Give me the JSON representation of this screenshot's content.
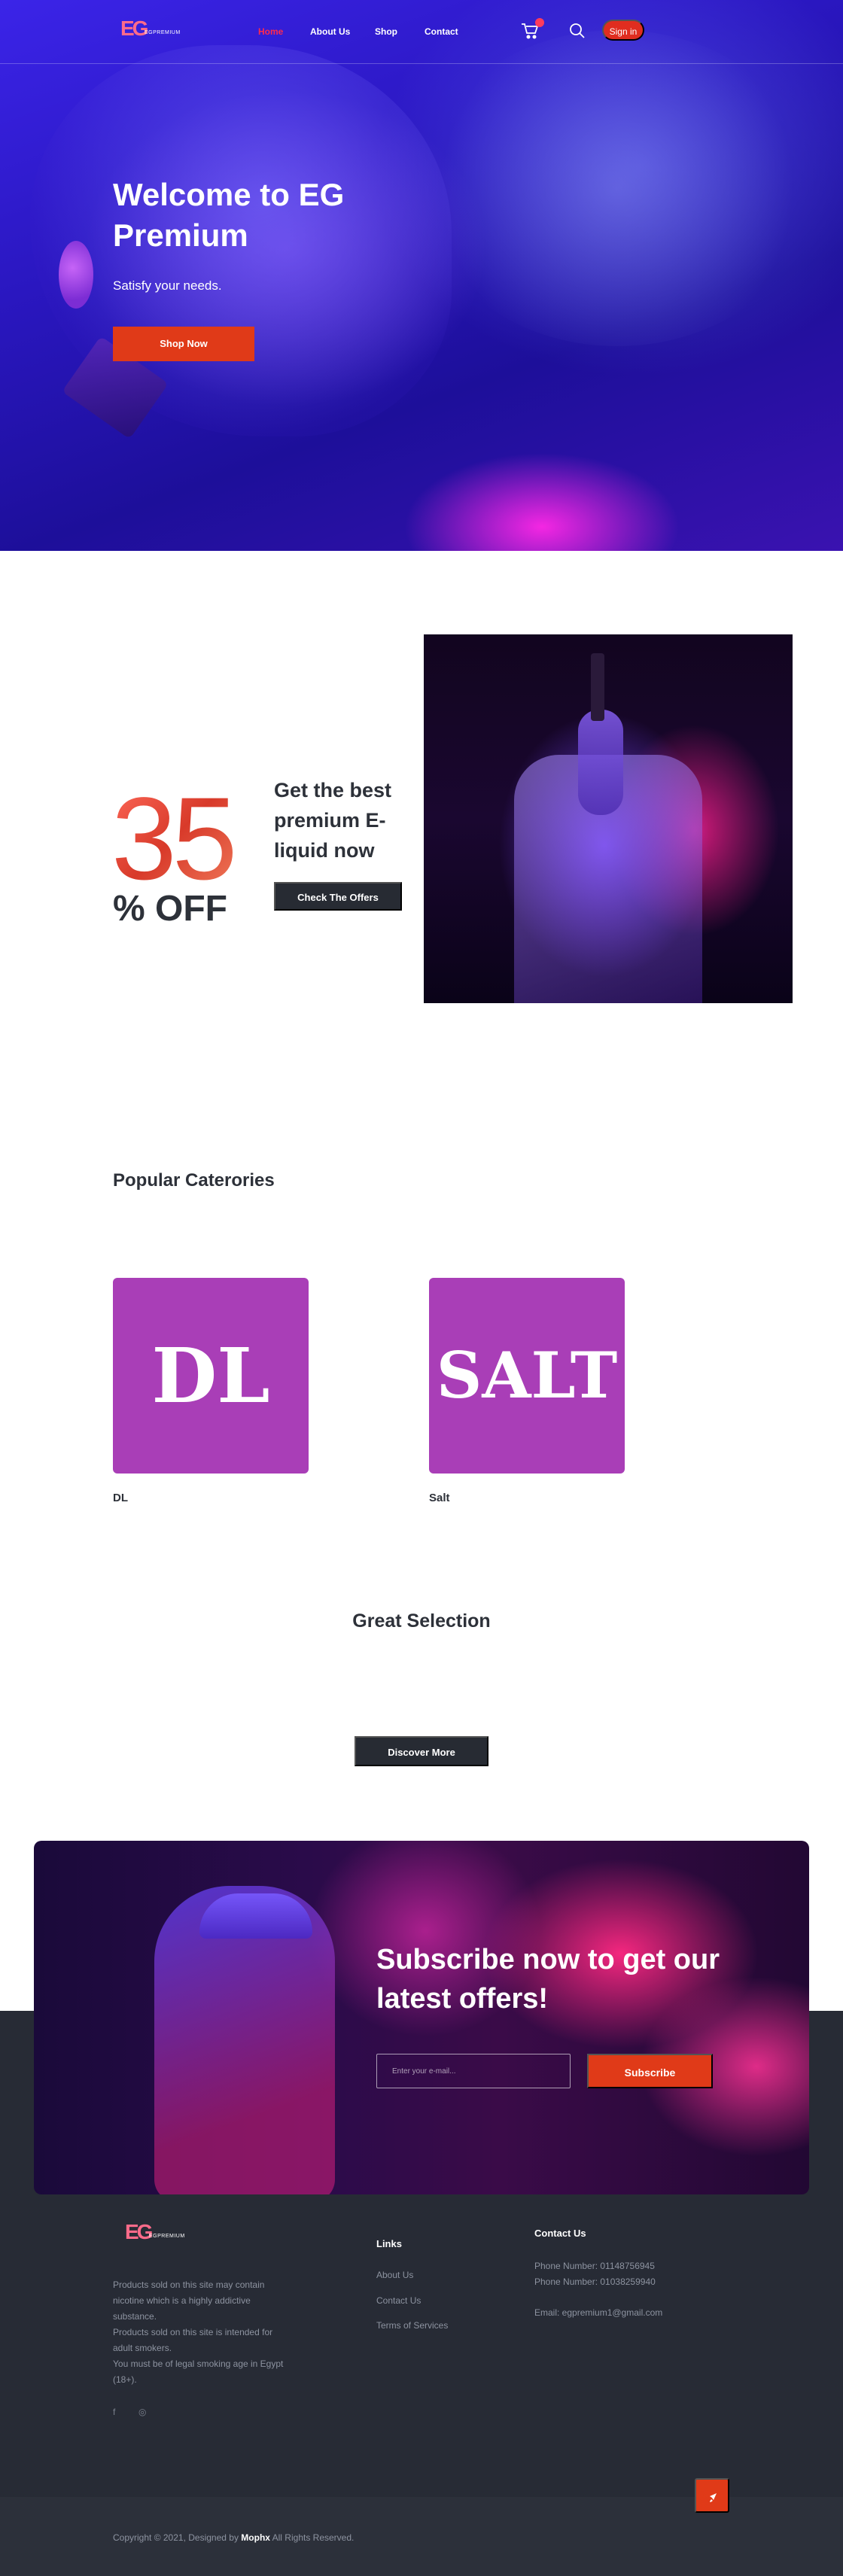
{
  "header": {
    "logo_text": "EG",
    "logo_subtext": "EGPREMIUM",
    "nav": [
      "Home",
      "About Us",
      "Shop",
      "Contact"
    ],
    "signin_label": "Sign in"
  },
  "hero": {
    "title": "Welcome to EG Premium",
    "subtitle": "Satisfy your needs.",
    "button": "Shop Now"
  },
  "offer": {
    "number": "35",
    "off": "% OFF",
    "text": "Get the best premium E-liquid now",
    "button": "Check The Offers"
  },
  "categories": {
    "title": "Popular Caterories",
    "items": [
      {
        "card": "DL",
        "label": "DL"
      },
      {
        "card": "SALT",
        "label": "Salt"
      }
    ]
  },
  "selection": {
    "title": "Great Selection",
    "button": "Discover More"
  },
  "subscribe": {
    "title": "Subscribe now to get our latest offers!",
    "placeholder": "Enter your e-mail...",
    "button": "Subscribe"
  },
  "footer": {
    "logo_text": "EG",
    "logo_subtext": "EGPREMIUM",
    "about_lines": [
      "Products sold on this site may contain nicotine which is a highly addictive substance.",
      "Products sold on this site is intended for adult smokers.",
      "You must be of legal smoking age in Egypt (18+)."
    ],
    "social": [
      "f",
      "◎"
    ],
    "links_heading": "Links",
    "links": [
      "About Us",
      "Contact Us",
      "Terms of Services"
    ],
    "contact_heading": "Contact Us",
    "phone1": "Phone Number: 01148756945",
    "phone2": "Phone Number: 01038259940",
    "email": "Email: egpremium1@gmail.com",
    "copyright_prefix": "Copyright © 2021, Designed by",
    "copyright_brand": "Mophx",
    "copyright_suffix": "All Rights Reserved."
  },
  "colors": {
    "accent": "#e03a18",
    "dark": "#272b33",
    "category": "#a93eb7",
    "footer": "#272b35"
  }
}
